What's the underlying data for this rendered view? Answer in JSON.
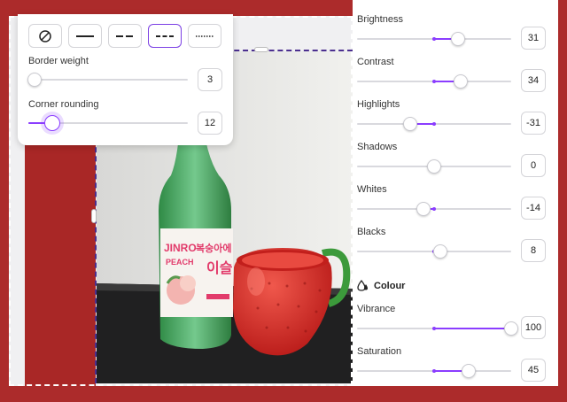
{
  "border_popover": {
    "styles": [
      {
        "name": "none",
        "selected": false
      },
      {
        "name": "solid",
        "selected": false
      },
      {
        "name": "long-dash",
        "selected": false
      },
      {
        "name": "dash",
        "selected": true
      },
      {
        "name": "dotted",
        "selected": false
      }
    ],
    "weight": {
      "label": "Border weight",
      "value": "3",
      "fraction": 0.04
    },
    "rounding": {
      "label": "Corner rounding",
      "value": "12",
      "fraction": 0.15
    }
  },
  "photo": {
    "bottle_brand": "JINRO",
    "bottle_flavor": "PEACH",
    "bottle_korean_1": "복숭아에",
    "bottle_korean_2": "이슬"
  },
  "adjust": {
    "sliders": [
      {
        "id": "brightness",
        "label": "Brightness",
        "value": "31",
        "num": 31
      },
      {
        "id": "contrast",
        "label": "Contrast",
        "value": "34",
        "num": 34
      },
      {
        "id": "highlights",
        "label": "Highlights",
        "value": "-31",
        "num": -31
      },
      {
        "id": "shadows",
        "label": "Shadows",
        "value": "0",
        "num": 0
      },
      {
        "id": "whites",
        "label": "Whites",
        "value": "-14",
        "num": -14
      },
      {
        "id": "blacks",
        "label": "Blacks",
        "value": "8",
        "num": 8
      }
    ],
    "colour_heading": "Colour",
    "colour_icon": "droplets-icon",
    "colour_sliders": [
      {
        "id": "vibrance",
        "label": "Vibrance",
        "value": "100",
        "num": 100
      },
      {
        "id": "saturation",
        "label": "Saturation",
        "value": "45",
        "num": 45
      }
    ]
  },
  "colors": {
    "accent": "#8b3dff",
    "background": "#ac2b2b"
  }
}
